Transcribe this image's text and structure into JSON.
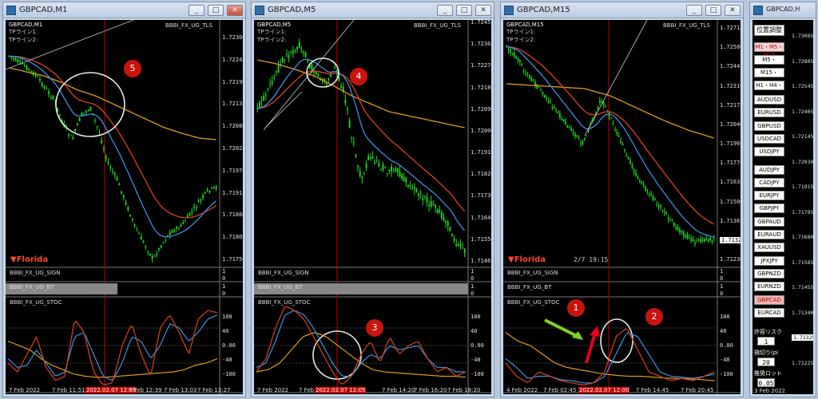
{
  "windows": [
    {
      "title": "GBPCAD,M1",
      "info1": "GBPCAD,M1",
      "tp1": "TPライン1:",
      "tp2": "TPライン2:",
      "indicator_top": "BBBI_FX_UG_TLS",
      "prices": [
        "1.72300",
        "1.72245",
        "1.72190",
        "1.72135",
        "1.72080",
        "1.72025",
        "1.71970",
        "1.71915",
        "1.71860",
        "1.71805",
        "1.71750"
      ],
      "sub1_name": "BBBI_FX_UG_SIGN",
      "sub2_name": "BBBI_FX_UG_BT",
      "sub3_name": "BBBI_FX_UG_STOC",
      "sub1_vals": [
        "1",
        "0"
      ],
      "sub2_vals": [
        "1",
        "0"
      ],
      "stoc_levels": [
        "100",
        "40",
        "0.00",
        "-40",
        "-100"
      ],
      "times": [
        "7 Feb 2022",
        "7 Feb 11:51",
        "2022.02.07 12:05",
        "7 Feb 12:39",
        "7 Feb 13:03",
        "7 Feb 13:27"
      ],
      "badge": "5",
      "brand": "▼Florida",
      "clock": ""
    },
    {
      "title": "GBPCAD,M5",
      "info1": "GBPCAD,M5",
      "tp1": "TPライン1:",
      "tp2": "TPライン2:",
      "indicator_top": "BBBI_FX_UG_TLS",
      "prices": [
        "1.72455",
        "1.72365",
        "1.72270",
        "1.72180",
        "1.72090",
        "1.72000",
        "1.71910",
        "1.71820",
        "1.71730",
        "1.71640",
        "1.71550",
        "1.71465"
      ],
      "sub1_name": "BBBI_FX_UG_SIGN",
      "sub2_name": "BBBI_FX_UG_BT",
      "sub3_name": "BBBI_FX_UG_STOC",
      "sub1_vals": [
        "1",
        "0"
      ],
      "sub2_vals": [
        "1",
        "0"
      ],
      "stoc_levels": [
        "100",
        "40",
        "0.00",
        "-40",
        "-100"
      ],
      "times": [
        "7 Feb 2022",
        "7 Feb 1",
        "2022.02.07 12:05",
        "7 Feb 14:20",
        "7 Feb 16:20",
        "7 Feb 18:20"
      ],
      "badge_top": "4",
      "badge_bottom": "3",
      "brand": "",
      "clock": ""
    },
    {
      "title": "GBPCAD,M15",
      "info1": "GBPCAD,M15",
      "tp1": "TPライン1:",
      "tp2": "TPライン2:",
      "indicator_top": "BBBI_FX_UG_TLS",
      "prices": [
        "1.72715",
        "1.72580",
        "1.72445",
        "1.72310",
        "1.72175",
        "1.72040",
        "1.71905",
        "1.71770",
        "1.71635",
        "1.71500",
        "1.71365",
        "1.71325",
        "1.71230"
      ],
      "sub1_name": "BBBI_FX_UG_SIGN",
      "sub2_name": "BBBI_FX_UG_BT",
      "sub3_name": "BBBI_FX_UG_STOC",
      "sub1_vals": [
        "1",
        "0"
      ],
      "sub2_vals": [
        "1",
        "0"
      ],
      "stoc_levels": [
        "100",
        "40",
        "0.00",
        "-40",
        "-100"
      ],
      "times": [
        "4 Feb 2022",
        "7 Feb 02:45",
        "2022.02.07 12:00",
        "7 Feb 14:45",
        "7 Feb 20:45"
      ],
      "badge_1": "1",
      "badge_2": "2",
      "brand": "▼Florida",
      "clock": "2/7 19:15"
    },
    {
      "title": "GBPCAD,H",
      "setting": "位置調整",
      "tf_buttons": [
        "M1・M5・M15",
        "M5・M15・H1",
        "M15・H1・H4",
        "H1・H4・D1"
      ],
      "pairs": [
        "AUDUSD",
        "EURUSD",
        "GBPUSD",
        "USDCAD",
        "USDJPY",
        "AUDJPY",
        "CADJPY",
        "EURJPY",
        "GBPJPY",
        "GBPAUD",
        "EURAUD",
        "XAUUSD",
        "JPXJPY",
        "GBPNZD",
        "EURNZD",
        "GBPCAD",
        "EURCAD"
      ],
      "selected_pair": "GBPCAD",
      "risk_label": "許容リスク",
      "risk_value": "1",
      "sl_label": "損切り(pi",
      "sl_value": "20",
      "lot_label": "推奨ロット",
      "lot_value": "0.05",
      "prices": [
        "1.73065",
        "1.72805",
        "1.72545",
        "1.72405",
        "1.72145",
        "1.72030",
        "1.71915",
        "1.71795",
        "1.71680",
        "1.71565",
        "1.71455",
        "1.71340",
        "1.71325",
        "1.71225"
      ],
      "date": "3 Feb 2022"
    }
  ],
  "colors": {
    "candle": "#22dd22",
    "ema_fast": "#3f8fe8",
    "ema_mid": "#e0401e",
    "ema_slow": "#e39a1a",
    "stoc_main": "#e0401e",
    "stoc_sig": "#3f8fe8",
    "stoc_slow": "#e39a1a",
    "vline": "#c00000",
    "badge": "#c8140f"
  }
}
